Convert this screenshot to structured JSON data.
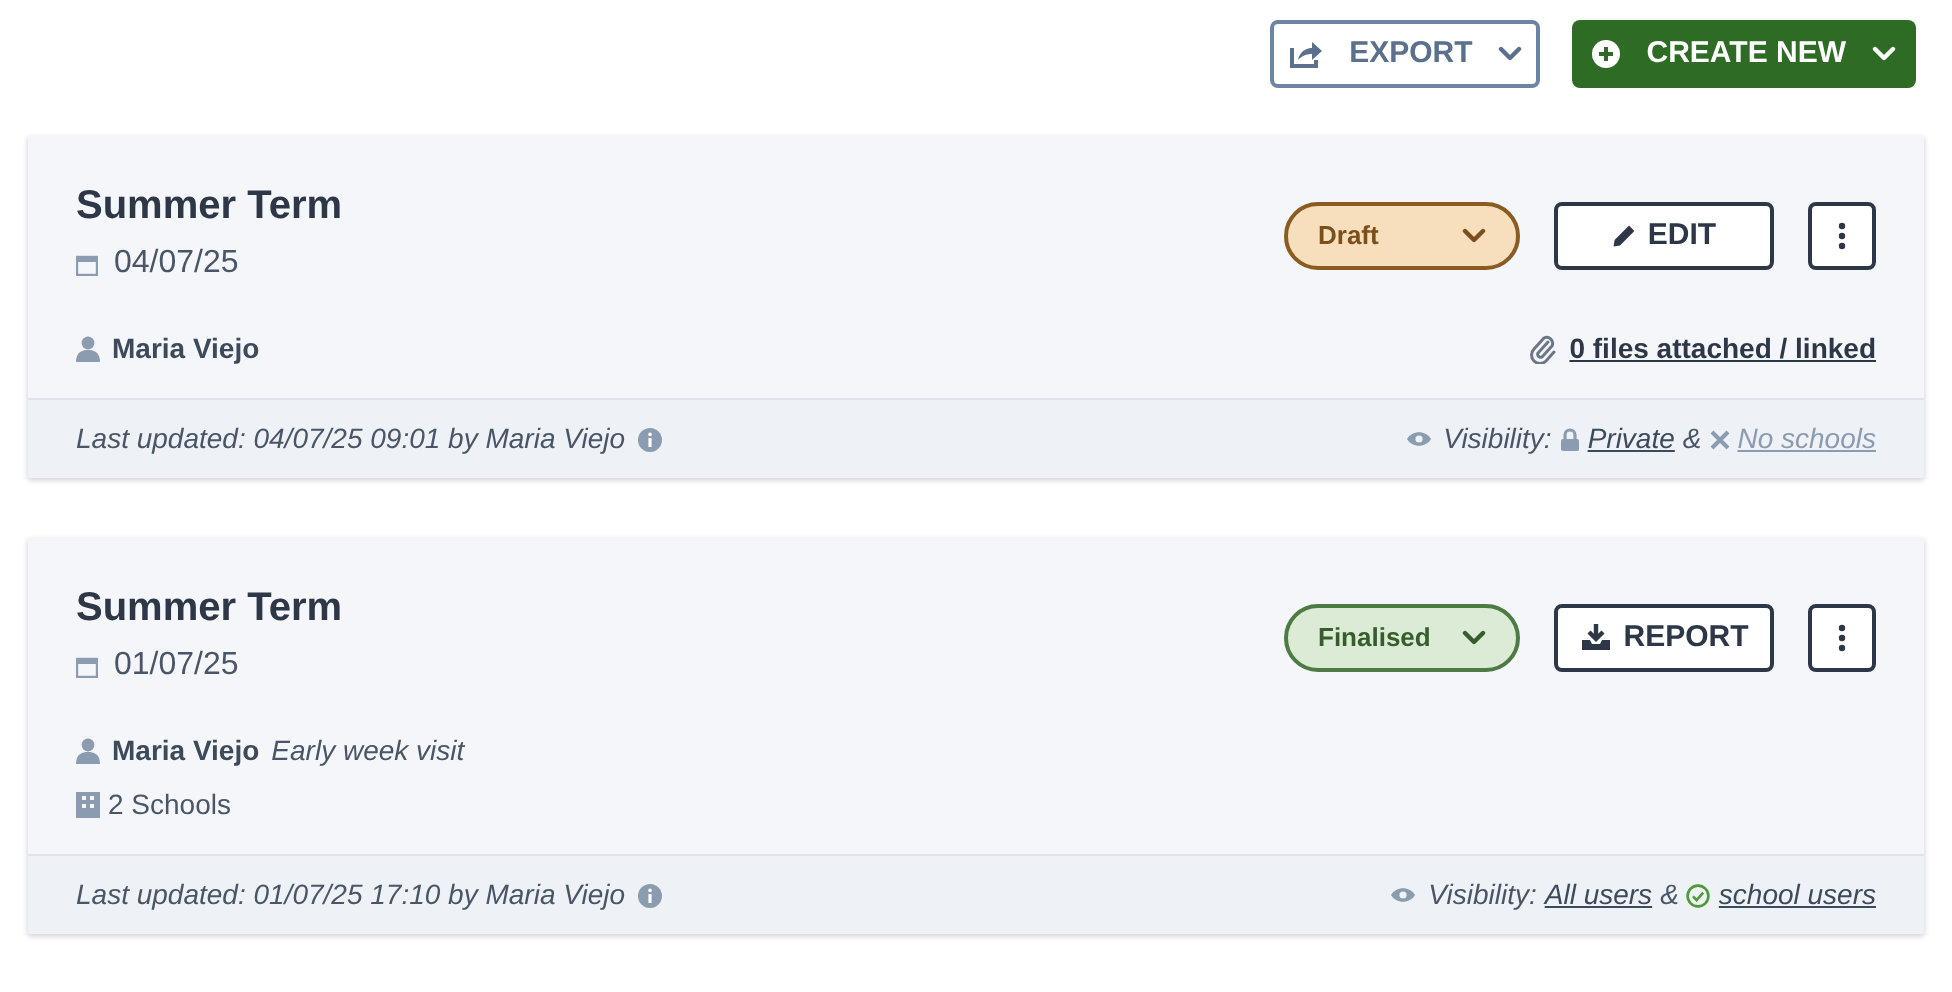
{
  "toolbar": {
    "export": {
      "label": "EXPORT"
    },
    "create": {
      "label": "CREATE NEW"
    }
  },
  "cards": [
    {
      "title": "Summer Term",
      "date": "04/07/25",
      "status": {
        "label": "Draft",
        "kind": "draft"
      },
      "action": {
        "label": "EDIT",
        "kind": "edit"
      },
      "author": "Maria Viejo",
      "attachments": "0 files attached / linked",
      "footer": {
        "updated": "Last updated: 04/07/25 09:01 by Maria Viejo",
        "visibility_label": "Visibility:",
        "audience": {
          "label": "Private",
          "kind": "lock"
        },
        "joiner": "&",
        "scope": {
          "label": "No schools",
          "kind": "cross"
        }
      }
    },
    {
      "title": "Summer Term",
      "date": "01/07/25",
      "status": {
        "label": "Finalised",
        "kind": "finalised"
      },
      "action": {
        "label": "REPORT",
        "kind": "report"
      },
      "author": "Maria Viejo",
      "note": "Early week visit",
      "schools": "2 Schools",
      "footer": {
        "updated": "Last updated: 01/07/25 17:10 by Maria Viejo",
        "visibility_label": "Visibility:",
        "audience": {
          "label": "All users",
          "kind": "plain"
        },
        "joiner": "&",
        "scope": {
          "label": "school users",
          "kind": "check"
        }
      }
    }
  ]
}
